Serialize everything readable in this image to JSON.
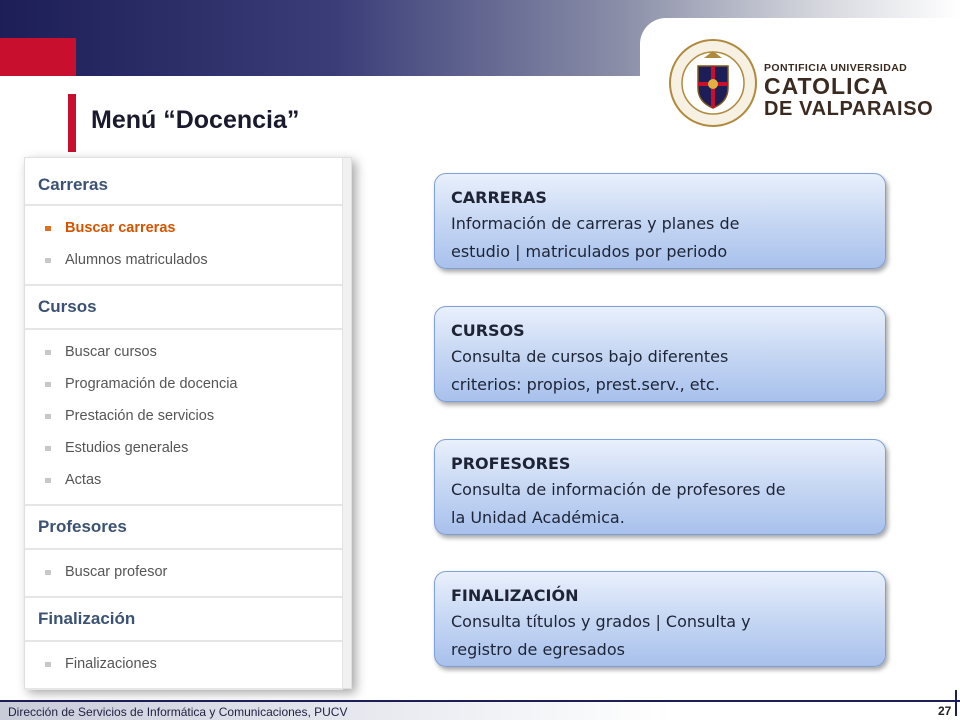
{
  "title": "Menú “Docencia”",
  "logo": {
    "line1": "PONTIFICIA UNIVERSIDAD",
    "line2": "CATOLICA",
    "line3": "DE VALPARAISO",
    "seal_ring_text": "PONTIFICIA UNIVERSIDAD CATOLICA DE VALPARAISO"
  },
  "menu": {
    "sections": [
      {
        "heading": "Carreras",
        "items": [
          "Buscar carreras",
          "Alumnos matriculados"
        ],
        "active_item": 0
      },
      {
        "heading": "Cursos",
        "items": [
          "Buscar cursos",
          "Programación de docencia",
          "Prestación de servicios",
          "Estudios generales",
          "Actas"
        ]
      },
      {
        "heading": "Profesores",
        "items": [
          "Buscar profesor"
        ]
      },
      {
        "heading": "Finalización",
        "items": [
          "Finalizaciones"
        ]
      }
    ]
  },
  "info_boxes": [
    {
      "title": "CARRERAS",
      "desc_line1": "Información de carreras y planes de",
      "desc_line2": "estudio | matriculados por periodo"
    },
    {
      "title": "CURSOS",
      "desc_line1": "Consulta de cursos bajo diferentes",
      "desc_line2": "criterios: propios, prest.serv., etc."
    },
    {
      "title": "PROFESORES",
      "desc_line1": "Consulta de información de profesores de",
      "desc_line2": "la Unidad Académica."
    },
    {
      "title": "FINALIZACIÓN",
      "desc_line1": "Consulta títulos y grados | Consulta y",
      "desc_line2": "registro de egresados"
    }
  ],
  "footer": {
    "text": "Dirección de Servicios de Informática y Comunicaciones, PUCV",
    "page": "27"
  },
  "colors": {
    "navy": "#1d1e57",
    "red": "#c8102e",
    "menu_heading": "#3b5275",
    "active_item": "#d35400"
  }
}
